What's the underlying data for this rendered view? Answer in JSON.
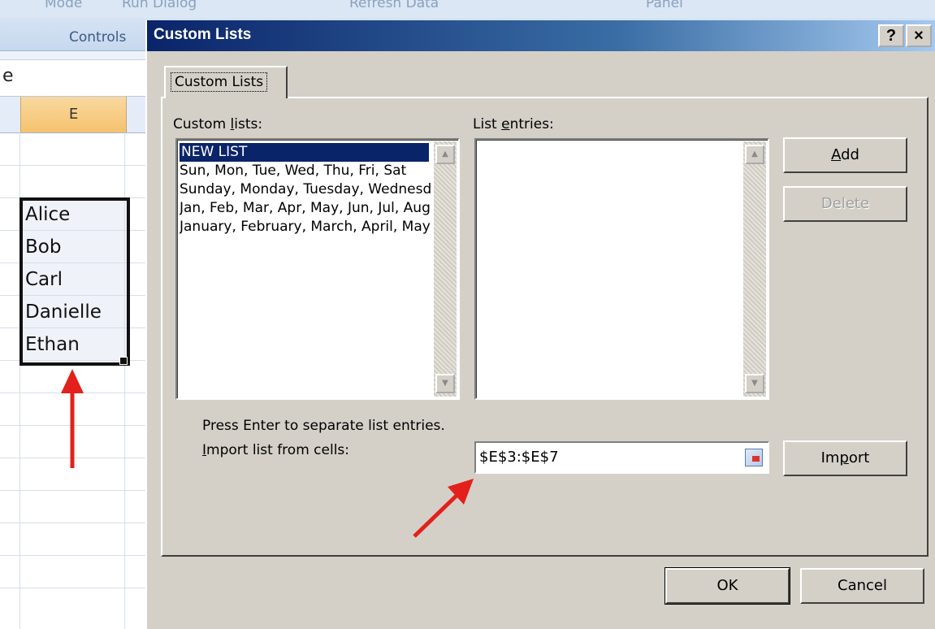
{
  "excel": {
    "ribbon_top": {
      "mode": "Mode",
      "run_dialog": "Run Dialog",
      "refresh_data": "Refresh Data",
      "panel": "Panel"
    },
    "ribbon_group_label": "Controls",
    "formula_bar_text": "e",
    "column_header": "E",
    "cells": [
      "Alice",
      "Bob",
      "Carl",
      "Danielle",
      "Ethan"
    ]
  },
  "dialog": {
    "title": "Custom Lists",
    "help_button": "?",
    "close_button": "×",
    "tab_label": "Custom Lists",
    "custom_lists_label": "Custom lists:",
    "custom_lists": [
      "NEW LIST",
      "Sun, Mon, Tue, Wed, Thu, Fri, Sat",
      "Sunday, Monday, Tuesday, Wednesday, Thursday, Friday, Saturday",
      "Jan, Feb, Mar, Apr, May, Jun, Jul, Aug, Sep, Oct, Nov, Dec",
      "January, February, March, April, May, June, July, August, September, October, November, December"
    ],
    "selected_index": 0,
    "list_entries_label": "List entries:",
    "add_button": "Add",
    "delete_button": "Delete",
    "hint": "Press Enter to separate list entries.",
    "import_label": "Import list from cells:",
    "import_range": "$E$3:$E$7",
    "import_button": "Import",
    "ok_button": "OK",
    "cancel_button": "Cancel"
  },
  "colors": {
    "dialog_bg": "#d4d0c8",
    "title_bar": "#0a246a",
    "selection": "#0a246a",
    "annotation_arrow": "#e3201b",
    "column_header_selected": "#f5c26e"
  }
}
